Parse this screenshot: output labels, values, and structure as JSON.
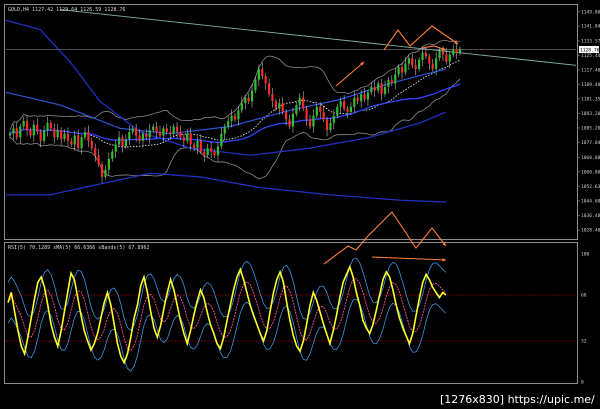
{
  "chart_data": [
    {
      "type": "candlestick",
      "header": "GOLD,H4  1127.42  1129.64  1126.59  1128.76",
      "y_ticks": [
        "1149.80",
        "1141.84",
        "1133.57",
        "1125.44",
        "1117.40",
        "1109.48",
        "1101.35",
        "1093.20",
        "1085.20",
        "1077.04",
        "1068.88",
        "1060.80",
        "1052.63",
        "1044.60",
        "1036.48",
        "1028.40"
      ],
      "ylim": [
        1024,
        1153
      ],
      "price_tag": "1128.76",
      "last_price": 1128.76,
      "colors": {
        "bull": "#2fbf2f",
        "bear": "#ff2a2a",
        "wick": "#dddddd",
        "envelope": "#8a8a8a",
        "ma_dotted": "#ffffff",
        "ma_fast": "#3344ff",
        "ma_mid": "#2d55d8",
        "ma_slow": "#2233cc",
        "trendline": "#7fb8a6",
        "annotation": "#ff7f3a"
      },
      "closes": [
        1082,
        1085,
        1080,
        1086,
        1089,
        1084,
        1081,
        1087,
        1083,
        1078,
        1084,
        1088,
        1085,
        1080,
        1084,
        1079,
        1082,
        1078,
        1076,
        1081,
        1074,
        1080,
        1083,
        1078,
        1074,
        1070,
        1065,
        1058,
        1062,
        1068,
        1072,
        1076,
        1080,
        1075,
        1079,
        1083,
        1085,
        1081,
        1078,
        1082,
        1080,
        1084,
        1086,
        1083,
        1081,
        1085,
        1083,
        1082,
        1086,
        1083,
        1080,
        1078,
        1082,
        1076,
        1074,
        1078,
        1072,
        1070,
        1074,
        1072,
        1070,
        1075,
        1082,
        1086,
        1089,
        1092,
        1090,
        1095,
        1099,
        1102,
        1100,
        1106,
        1112,
        1118,
        1114,
        1110,
        1104,
        1100,
        1096,
        1099,
        1094,
        1090,
        1086,
        1093,
        1098,
        1102,
        1096,
        1090,
        1086,
        1092,
        1097,
        1094,
        1090,
        1084,
        1088,
        1092,
        1097,
        1100,
        1096,
        1094,
        1097,
        1102,
        1100,
        1104,
        1101,
        1105,
        1108,
        1106,
        1110,
        1104,
        1108,
        1112,
        1110,
        1115,
        1119,
        1116,
        1121,
        1124,
        1120,
        1118,
        1123,
        1127,
        1125,
        1121,
        1118,
        1124,
        1128,
        1126,
        1122,
        1126,
        1129,
        1127,
        1129
      ]
    },
    {
      "type": "line",
      "header": "RSI(5) 70.1289  sMA(5) 66.6366  sBands(5) 67.8962",
      "y_ticks": [
        "100",
        "68",
        "32",
        "0"
      ],
      "ylim": [
        0,
        100
      ],
      "levels": [
        68,
        32
      ],
      "colors": {
        "rsi": "#ffff22",
        "sma": "#ff4fa0",
        "bands": "#3fa8ff",
        "level": "#7a0000"
      },
      "rsi": [
        62,
        70,
        55,
        40,
        28,
        22,
        35,
        50,
        65,
        78,
        82,
        74,
        60,
        45,
        35,
        28,
        40,
        55,
        70,
        85,
        80,
        66,
        52,
        40,
        32,
        25,
        30,
        38,
        50,
        62,
        70,
        60,
        45,
        30,
        20,
        15,
        22,
        35,
        50,
        60,
        75,
        82,
        70,
        55,
        42,
        35,
        44,
        58,
        70,
        80,
        72,
        60,
        48,
        38,
        30,
        40,
        52,
        63,
        72,
        66,
        55,
        45,
        38,
        30,
        26,
        35,
        48,
        60,
        72,
        82,
        88,
        80,
        70,
        60,
        52,
        45,
        38,
        32,
        40,
        55,
        70,
        80,
        86,
        78,
        62,
        48,
        36,
        28,
        24,
        32,
        45,
        60,
        70,
        64,
        55,
        46,
        38,
        30,
        40,
        52,
        66,
        78,
        84,
        90,
        82,
        70,
        60,
        48,
        42,
        38,
        45,
        56,
        68,
        80,
        86,
        82,
        72,
        60,
        50,
        42,
        36,
        30,
        38,
        52,
        66,
        78,
        84,
        80,
        74,
        70,
        66,
        70,
        68
      ],
      "bands_width": 16
    }
  ],
  "watermark": "[1276x830] https://upic.me/"
}
